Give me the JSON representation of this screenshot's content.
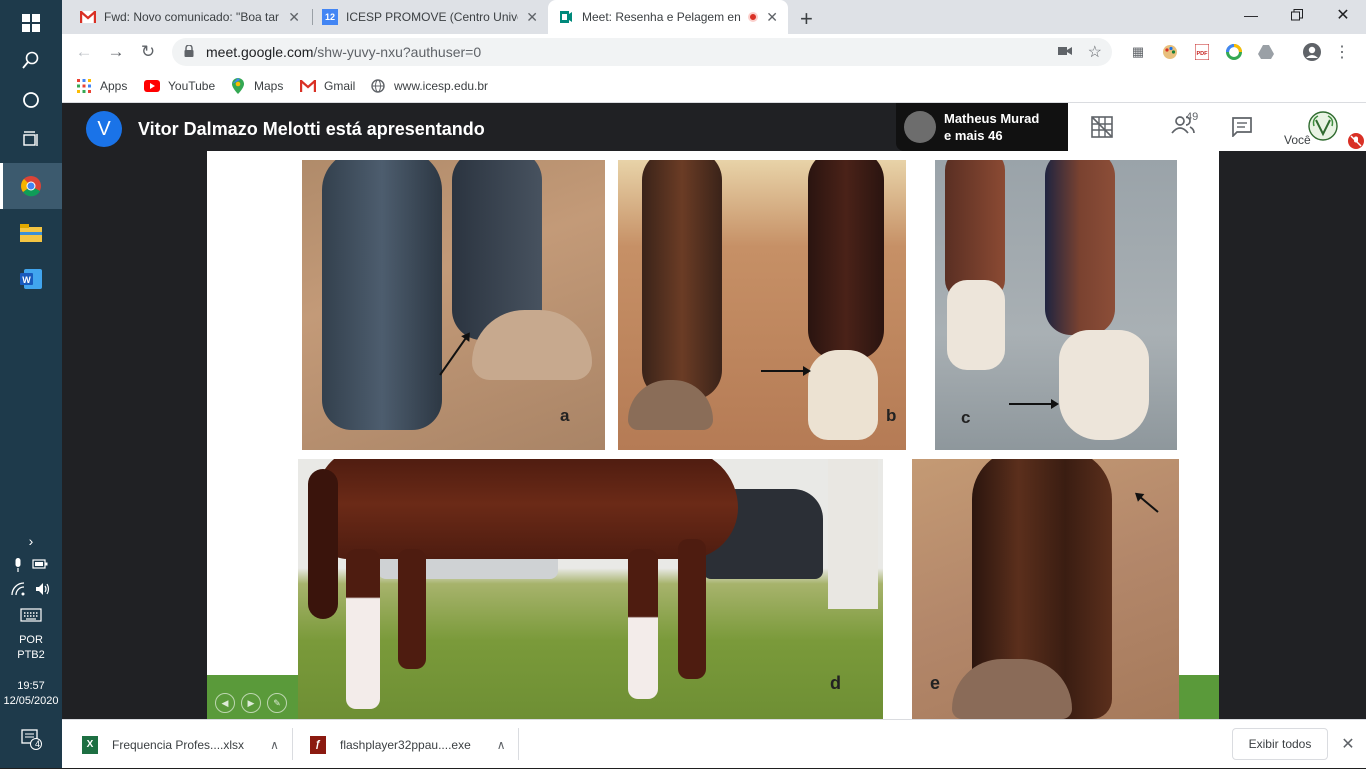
{
  "taskbar": {
    "icons": [
      "windows-start-icon",
      "search-icon",
      "cortana-icon",
      "task-view-icon",
      "chrome-icon",
      "file-explorer-icon",
      "word-icon"
    ],
    "language_top": "POR",
    "language_bottom": "PTB2",
    "time": "19:57",
    "date": "12/05/2020",
    "notifications_count": "4"
  },
  "browser": {
    "tabs": [
      {
        "title": "Fwd: Novo comunicado: \"Boa tar",
        "favicon": "gmail-icon",
        "active": false
      },
      {
        "title": "ICESP PROMOVE (Centro Univers",
        "favicon": "calendar-icon",
        "favicon_text": "12",
        "active": false
      },
      {
        "title": "Meet: Resenha e Pelagem en",
        "favicon": "meet-icon",
        "active": true
      }
    ],
    "new_tab_label": "+",
    "address": {
      "host": "meet.google.com",
      "path": "/shw-yuvy-nxu?authuser=0"
    },
    "bookmarks": [
      {
        "label": "Apps",
        "icon": "apps-grid-icon"
      },
      {
        "label": "YouTube",
        "icon": "youtube-icon"
      },
      {
        "label": "Maps",
        "icon": "maps-icon"
      },
      {
        "label": "Gmail",
        "icon": "gmail-icon"
      },
      {
        "label": "www.icesp.edu.br",
        "icon": "globe-icon"
      }
    ]
  },
  "meet": {
    "presenter_initial": "V",
    "presenter_text": "Vitor Dalmazo Melotti está apresentando",
    "participant_name": "Matheus Murad",
    "participant_more": "e mais 46",
    "participant_count": "49",
    "self_label": "Você",
    "slide_labels": [
      "a",
      "b",
      "c",
      "d",
      "e"
    ]
  },
  "downloads": {
    "items": [
      {
        "name": "Frequencia Profes....xlsx",
        "icon": "excel-icon"
      },
      {
        "name": "flashplayer32ppau....exe",
        "icon": "flash-icon"
      }
    ],
    "show_all": "Exibir todos"
  },
  "colors": {
    "taskbar": "#1e3a4b",
    "meet_bg": "#202124",
    "presenter_avatar": "#1a73e8",
    "slide_green": "#5a9a3a"
  }
}
